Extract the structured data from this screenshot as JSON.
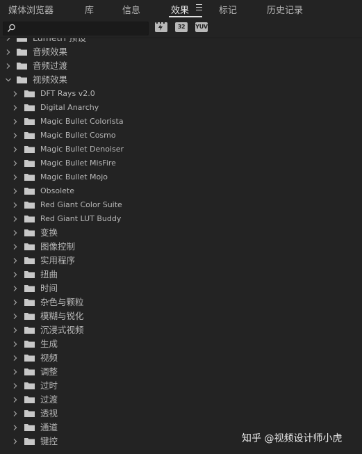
{
  "tabs": [
    {
      "label": "媒体浏览器",
      "active": false
    },
    {
      "label": "库",
      "active": false
    },
    {
      "label": "信息",
      "active": false
    },
    {
      "label": "效果",
      "active": true
    },
    {
      "label": "标记",
      "active": false
    },
    {
      "label": "历史记录",
      "active": false
    }
  ],
  "search": {
    "value": "",
    "placeholder": ""
  },
  "filters": [
    {
      "label": "",
      "icon": "accelerated-effects-icon"
    },
    {
      "label": "32",
      "icon": "32-bit-color-icon"
    },
    {
      "label": "YUV",
      "icon": "yuv-effects-icon"
    }
  ],
  "tree": {
    "top_items": [
      {
        "label": "Lumetri 预设",
        "expanded": false
      },
      {
        "label": "音频效果",
        "expanded": false
      },
      {
        "label": "音频过渡",
        "expanded": false
      },
      {
        "label": "视频效果",
        "expanded": true
      }
    ],
    "video_effects": [
      "DFT Rays v2.0",
      "Digital Anarchy",
      "Magic Bullet Colorista",
      "Magic Bullet Cosmo",
      "Magic Bullet Denoiser",
      "Magic Bullet MisFire",
      "Magic Bullet Mojo",
      "Obsolete",
      "Red Giant Color Suite",
      "Red Giant LUT Buddy",
      "变换",
      "图像控制",
      "实用程序",
      "扭曲",
      "时间",
      "杂色与颗粒",
      "模糊与锐化",
      "沉浸式视频",
      "生成",
      "视频",
      "调整",
      "过时",
      "过渡",
      "透视",
      "通道",
      "键控"
    ]
  },
  "watermark": "知乎 @视频设计师小虎",
  "colors": {
    "panel_bg": "#232323",
    "text": "#b8b8b8",
    "active_tab": "#e6e6e6",
    "folder": "#c8c8c8"
  }
}
